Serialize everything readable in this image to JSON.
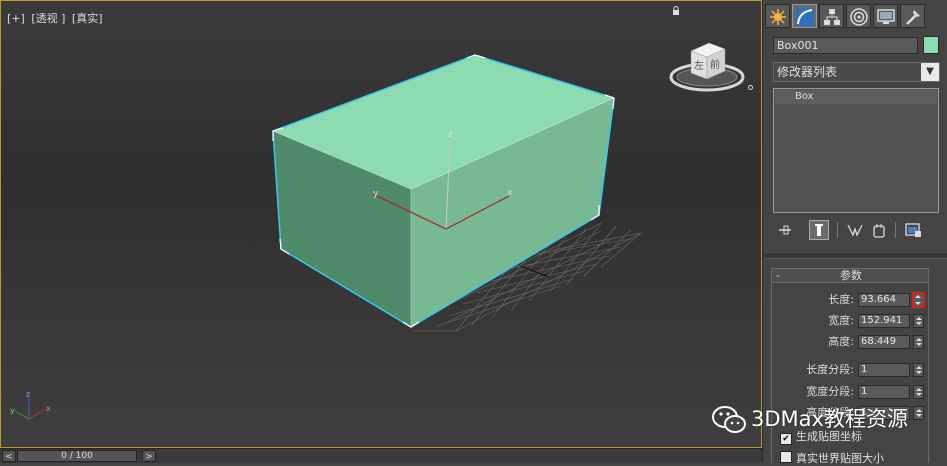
{
  "viewport": {
    "label_parts": [
      "[+]",
      "[透视 ]",
      "[真实]"
    ],
    "viewcube_left": "左",
    "viewcube_front": "前",
    "axis_x": "x",
    "axis_y": "y",
    "axis_z": "z",
    "box_color": "#8ddbb0",
    "selection_color": "#39c7ef"
  },
  "timebar": {
    "prev_label": "<",
    "frame_text": "0 / 100",
    "next_label": ">"
  },
  "panel": {
    "tabs": [
      "create-icon",
      "modify-icon",
      "hierarchy-icon",
      "motion-icon",
      "display-icon",
      "utilities-icon"
    ],
    "object_name": "Box001",
    "object_color": "#8ddbb0",
    "modifier_list": "修改器列表",
    "stack_items": [
      "Box"
    ],
    "stack_tools": [
      "pin-stack-icon",
      "show-end-result-icon",
      "make-unique-icon",
      "remove-modifier-icon",
      "configure-sets-icon"
    ]
  },
  "params": {
    "title": "参数",
    "collapse_symbol": "-",
    "fields": [
      {
        "label": "长度:",
        "value": "93.664"
      },
      {
        "label": "宽度:",
        "value": "152.941"
      },
      {
        "label": "高度:",
        "value": "68.449"
      },
      {
        "label": "长度分段:",
        "value": "1"
      },
      {
        "label": "宽度分段:",
        "value": "1"
      },
      {
        "label": "高度分段:",
        "value": "1"
      }
    ],
    "checkboxes": [
      {
        "label": "生成贴图坐标",
        "checked": true
      },
      {
        "label": "真实世界贴图大小",
        "checked": false
      }
    ]
  },
  "watermark": {
    "text": "3DMax教程资源"
  }
}
